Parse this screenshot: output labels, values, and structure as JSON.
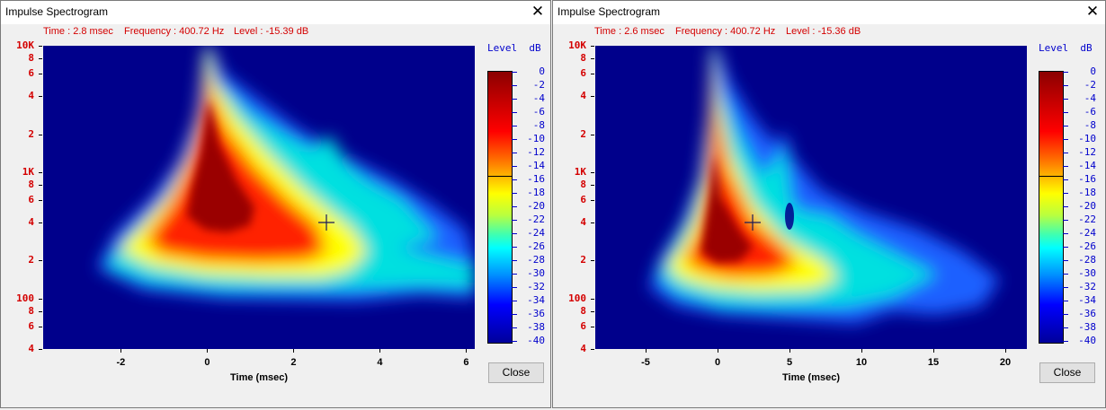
{
  "windows": [
    {
      "title": "Impulse Spectrogram",
      "status": {
        "time": "Time : 2.8 msec",
        "frequency": "Frequency : 400.72 Hz",
        "level": "Level : -15.39 dB"
      },
      "close_label": "Close",
      "chart_data": {
        "type": "heatmap",
        "xlabel": "Time (msec)",
        "ylabel": "",
        "x_range": [
          -3.8,
          6.2
        ],
        "y_range": [
          40,
          10000
        ],
        "y_scale": "log",
        "x_ticks": [
          "-2",
          "0",
          "2",
          "4",
          "6"
        ],
        "y_ticks": [
          "10K",
          "8",
          "6",
          "4",
          "2",
          "1K",
          "8",
          "6",
          "4",
          "2",
          "100",
          "8",
          "6",
          "4"
        ],
        "colorbar": {
          "title": "Level",
          "unit": "dB",
          "range": [
            -40,
            0
          ],
          "ticks": [
            "0",
            "-2",
            "-4",
            "-6",
            "-8",
            "-10",
            "-12",
            "-14",
            "-16",
            "-18",
            "-20",
            "-22",
            "-24",
            "-26",
            "-28",
            "-30",
            "-32",
            "-34",
            "-36",
            "-38",
            "-40"
          ]
        },
        "cursor": {
          "time_msec": 2.8,
          "frequency_hz": 400.72,
          "level_db": -15.39
        },
        "peak": {
          "time_msec": 0,
          "frequency_hz": 700
        }
      }
    },
    {
      "title": "Impulse Spectrogram",
      "status": {
        "time": "Time : 2.6 msec",
        "frequency": "Frequency : 400.72 Hz",
        "level": "Level : -15.36 dB"
      },
      "close_label": "Close",
      "chart_data": {
        "type": "heatmap",
        "xlabel": "Time (msec)",
        "ylabel": "",
        "x_range": [
          -8.5,
          21.5
        ],
        "y_range": [
          40,
          10000
        ],
        "y_scale": "log",
        "x_ticks": [
          "-5",
          "0",
          "5",
          "10",
          "15",
          "20"
        ],
        "y_ticks": [
          "10K",
          "8",
          "6",
          "4",
          "2",
          "1K",
          "8",
          "6",
          "4",
          "2",
          "100",
          "8",
          "6",
          "4"
        ],
        "colorbar": {
          "title": "Level",
          "unit": "dB",
          "range": [
            -40,
            0
          ],
          "ticks": [
            "0",
            "-2",
            "-4",
            "-6",
            "-8",
            "-10",
            "-12",
            "-14",
            "-16",
            "-18",
            "-20",
            "-22",
            "-24",
            "-26",
            "-28",
            "-30",
            "-32",
            "-34",
            "-36",
            "-38",
            "-40"
          ]
        },
        "cursor": {
          "time_msec": 2.6,
          "frequency_hz": 400.72,
          "level_db": -15.36
        },
        "peak": {
          "time_msec": 0,
          "frequency_hz": 350
        }
      }
    }
  ]
}
